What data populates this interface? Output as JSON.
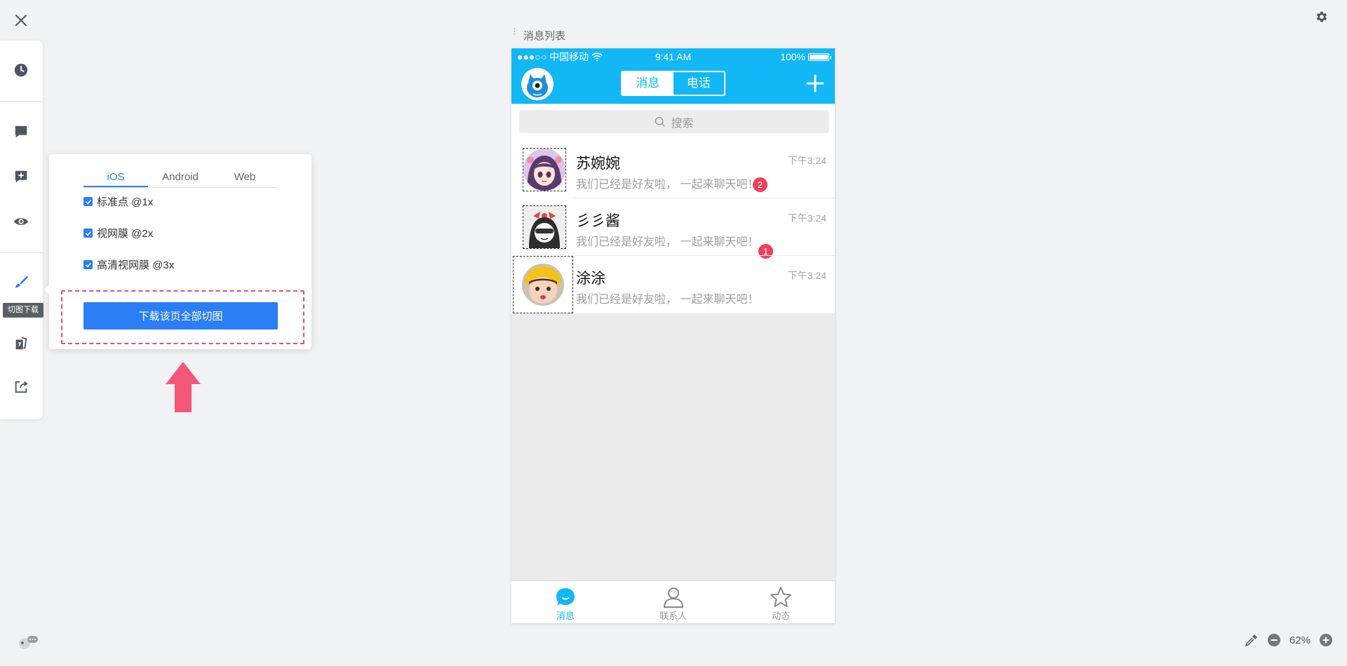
{
  "window": {
    "close_icon": "close-icon",
    "settings_icon": "gear-icon"
  },
  "toolbar": {
    "items": [
      {
        "name": "history",
        "icon": "clock-icon"
      },
      {
        "name": "comments",
        "icon": "comment-icon"
      },
      {
        "name": "add-comment",
        "icon": "comment-plus-icon"
      },
      {
        "name": "preview",
        "icon": "eye-icon"
      },
      {
        "name": "slice-download",
        "icon": "brush-icon",
        "active": true
      },
      {
        "name": "assets",
        "icon": "cards-icon"
      },
      {
        "name": "share",
        "icon": "share-icon"
      }
    ],
    "tooltip": "切图下载"
  },
  "download_panel": {
    "tabs": [
      "iOS",
      "Android",
      "Web"
    ],
    "active_tab": "iOS",
    "options": [
      {
        "label": "标准点 @1x",
        "checked": true
      },
      {
        "label": "视网膜 @2x",
        "checked": true
      },
      {
        "label": "高清视网膜 @3x",
        "checked": true
      }
    ],
    "button_label": "下载该页全部切图",
    "highlight_color": "#ef4b6e",
    "accent_color": "#2b7ef5"
  },
  "artboard": {
    "title": "消息列表"
  },
  "phone": {
    "status": {
      "carrier": "●●●○○ 中国移动",
      "time": "9:41 AM",
      "battery": "100%",
      "battery_level": 1.0
    },
    "brand_color": "#12b7f5",
    "segments": [
      "消息",
      "电话"
    ],
    "active_segment": "消息",
    "search_placeholder": "搜索",
    "conversations": [
      {
        "name": "苏婉婉",
        "message": "我们已经是好友啦， 一起来聊天吧！",
        "time": "下午3:24",
        "badge": "2"
      },
      {
        "name": "彡彡酱",
        "message": "我们已经是好友啦， 一起来聊天吧！",
        "time": "下午3:24",
        "badge": "1"
      },
      {
        "name": "涂涂",
        "message": "我们已经是好友啦， 一起来聊天吧！",
        "time": "下午3:24",
        "badge": ""
      }
    ],
    "tabbar": [
      {
        "label": "消息",
        "icon": "chat-bubble-icon",
        "active": true
      },
      {
        "label": "联系人",
        "icon": "person-icon",
        "active": false
      },
      {
        "label": "动态",
        "icon": "star-icon",
        "active": false
      }
    ]
  },
  "zoom": {
    "level": "62%"
  }
}
